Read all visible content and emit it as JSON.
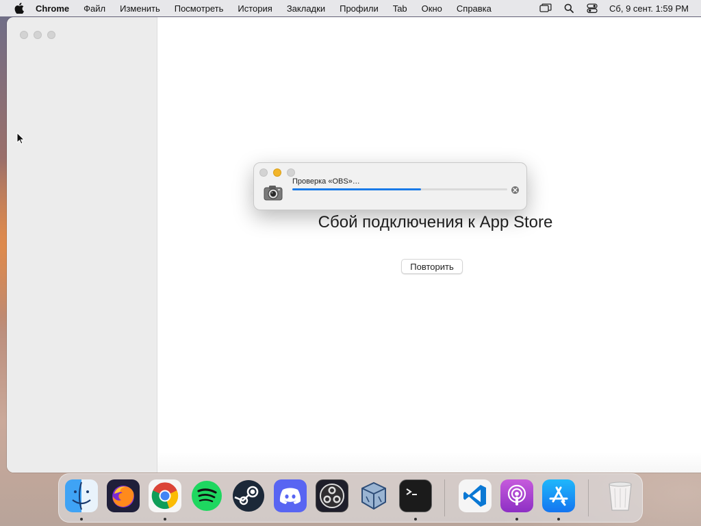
{
  "menubar": {
    "app_name": "Chrome",
    "items": [
      "Файл",
      "Изменить",
      "Посмотреть",
      "История",
      "Закладки",
      "Профили",
      "Tab",
      "Окно",
      "Справка"
    ],
    "datetime": "Сб, 9 сент.  1:59 PM",
    "icons": [
      "apple-icon",
      "screen-mirroring-icon",
      "spotlight-search-icon",
      "control-center-icon"
    ]
  },
  "window": {
    "error_title": "Сбой подключения к App Store",
    "retry_label": "Повторить"
  },
  "dialog": {
    "status_text": "Проверка «OBS»…",
    "progress": 0.6,
    "icon": "gatekeeper-camera-icon"
  },
  "dock": {
    "items": [
      {
        "name": "Finder",
        "icon": "finder-icon",
        "running": true
      },
      {
        "name": "Firefox",
        "icon": "firefox-icon",
        "running": false
      },
      {
        "name": "Chrome",
        "icon": "chrome-icon",
        "running": true
      },
      {
        "name": "Spotify",
        "icon": "spotify-icon",
        "running": false
      },
      {
        "name": "Steam",
        "icon": "steam-icon",
        "running": false
      },
      {
        "name": "Discord",
        "icon": "discord-icon",
        "running": false
      },
      {
        "name": "OBS",
        "icon": "obs-icon",
        "running": false
      },
      {
        "name": "VirtualBox",
        "icon": "virtualbox-icon",
        "running": false
      },
      {
        "name": "Terminal",
        "icon": "terminal-icon",
        "running": true
      },
      {
        "name": "Visual Studio Code",
        "icon": "vscode-icon",
        "running": false
      },
      {
        "name": "Podcasts",
        "icon": "podcasts-icon",
        "running": true
      },
      {
        "name": "App Store",
        "icon": "app-store-icon",
        "running": true
      },
      {
        "name": "Trash",
        "icon": "trash-icon",
        "running": false
      }
    ]
  },
  "colors": {
    "accent": "#1a7ae8",
    "minimize_yellow": "#f2b52a"
  }
}
